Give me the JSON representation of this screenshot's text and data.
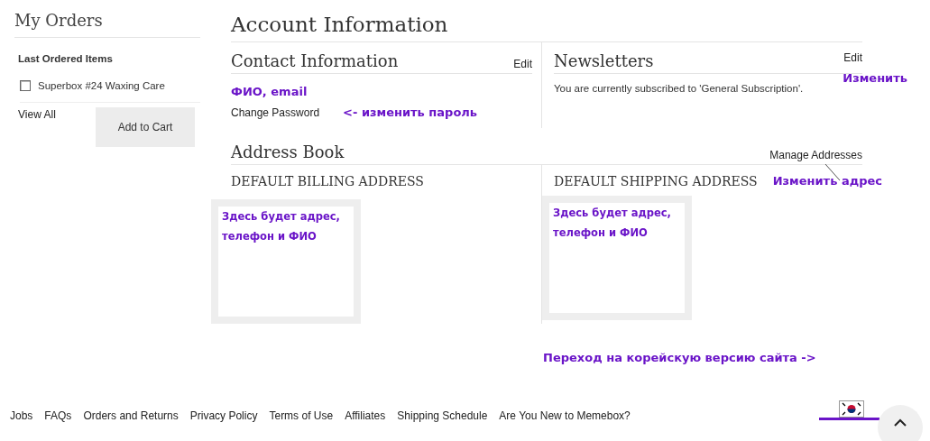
{
  "sidebar": {
    "title": "My Orders",
    "section_title": "Last Ordered Items",
    "items": [
      {
        "label": "Superbox #24 Waxing Care",
        "checked": false
      }
    ],
    "view_all": "View All",
    "add_to_cart": "Add to Cart"
  },
  "page_title": "Account Information",
  "contact": {
    "title": "Contact Information",
    "edit": "Edit",
    "note": "ФИО, email",
    "change_password": "Change Password",
    "password_note": "<- изменить пароль"
  },
  "newsletters": {
    "title": "Newsletters",
    "edit": "Edit",
    "edit_note": "Изменить",
    "text": "You are currently subscribed to 'General Subscription'."
  },
  "address_book": {
    "title": "Address Book",
    "manage": "Manage Addresses",
    "manage_note": "Изменить адрес",
    "billing_title": "DEFAULT BILLING ADDRESS",
    "billing_note": "Здесь будет адрес, телефон и ФИО",
    "shipping_title": "DEFAULT SHIPPING ADDRESS",
    "shipping_note": "Здесь будет адрес, телефон и ФИО"
  },
  "korean_note": "Переход на корейскую версию сайта ->",
  "footer_links": [
    "Jobs",
    "FAQs",
    "Orders and Returns",
    "Privacy Policy",
    "Terms of Use",
    "Affiliates",
    "Shipping Schedule",
    "Are You New to Memebox?"
  ]
}
